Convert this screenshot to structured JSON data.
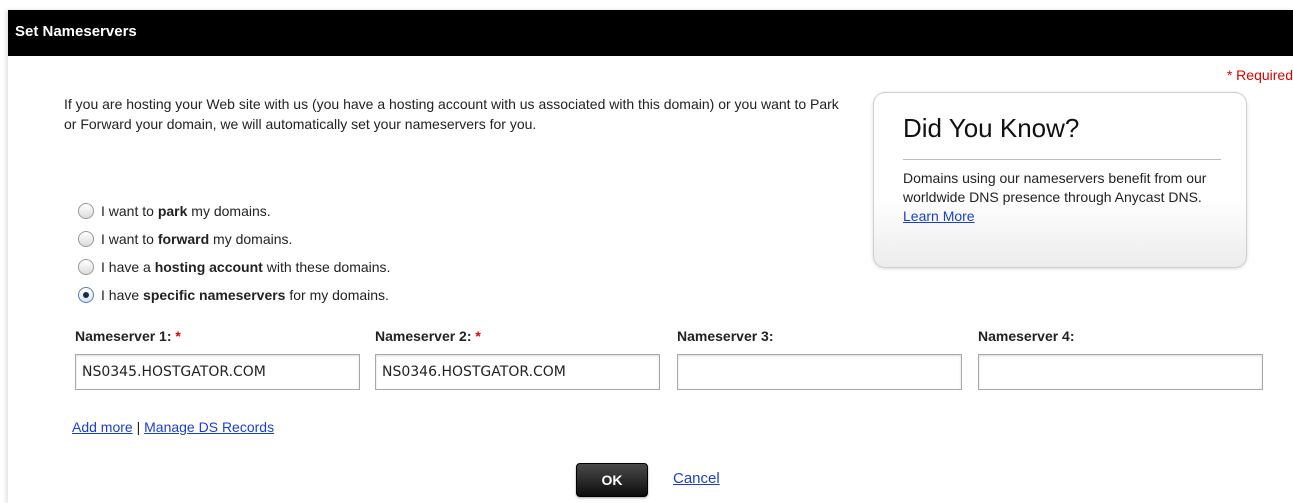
{
  "dialog": {
    "title": "Set Nameservers",
    "required_note": "* Required",
    "intro_text": "If you are hosting your Web site with us (you have a hosting account with us associated with this domain) or you want to Park or Forward your domain, we will automatically set your nameservers for you."
  },
  "options": [
    {
      "pre": "I want to ",
      "bold": "park",
      "post": " my domains.",
      "checked": false
    },
    {
      "pre": "I want to ",
      "bold": "forward",
      "post": " my domains.",
      "checked": false
    },
    {
      "pre": "I have a ",
      "bold": "hosting account",
      "post": " with these domains.",
      "checked": false
    },
    {
      "pre": "I have ",
      "bold": "specific nameservers",
      "post": " for my domains.",
      "checked": true
    }
  ],
  "nameservers": [
    {
      "label": "Nameserver 1:",
      "required_mark": "*",
      "value": "NS0345.HOSTGATOR.COM"
    },
    {
      "label": "Nameserver 2:",
      "required_mark": "*",
      "value": "NS0346.HOSTGATOR.COM"
    },
    {
      "label": "Nameserver 3:",
      "required_mark": "",
      "value": ""
    },
    {
      "label": "Nameserver 4:",
      "required_mark": "",
      "value": ""
    }
  ],
  "links": {
    "add_more": "Add more",
    "separator": "|",
    "manage_ds": "Manage DS Records"
  },
  "did_you_know": {
    "title": "Did You Know?",
    "body": "Domains using our nameservers benefit from our worldwide DNS presence through Anycast DNS.",
    "link": "Learn More"
  },
  "actions": {
    "ok_label": "OK",
    "cancel_label": "Cancel"
  },
  "colors": {
    "titlebar_bg": "#000000",
    "required_red": "#e00000",
    "link_blue": "#1a3fd0"
  }
}
